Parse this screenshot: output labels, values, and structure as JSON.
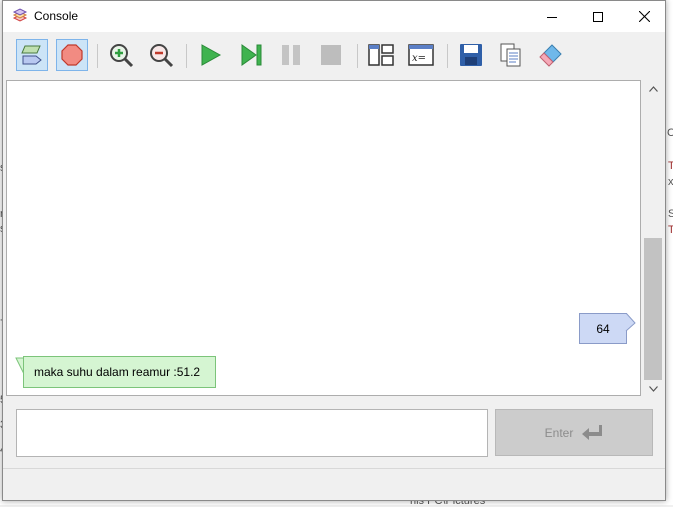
{
  "window": {
    "title": "Console"
  },
  "toolbar": {
    "buttons": [
      {
        "name": "input-mode-button",
        "icon": "parallelogram-icon"
      },
      {
        "name": "stop-sign-button",
        "icon": "octagon-icon"
      },
      {
        "name": "zoom-in-button",
        "icon": "zoom-in-icon"
      },
      {
        "name": "zoom-out-button",
        "icon": "zoom-out-icon"
      },
      {
        "name": "run-button",
        "icon": "play-icon"
      },
      {
        "name": "step-button",
        "icon": "step-icon"
      },
      {
        "name": "pause-button",
        "icon": "pause-icon"
      },
      {
        "name": "stop-button",
        "icon": "stop-icon"
      },
      {
        "name": "layout-button",
        "icon": "layout-icon"
      },
      {
        "name": "variables-button",
        "icon": "variables-icon"
      },
      {
        "name": "save-button",
        "icon": "save-icon"
      },
      {
        "name": "copy-button",
        "icon": "copy-icon"
      },
      {
        "name": "clear-button",
        "icon": "eraser-icon"
      }
    ]
  },
  "console": {
    "input_value": "64",
    "output_text": "maka suhu dalam reamur :51.2"
  },
  "input_bar": {
    "value": "",
    "enter_label": "Enter"
  },
  "background": {
    "fragments": [
      "s",
      "r",
      "s",
      "7",
      "5",
      "3",
      "4",
      "C",
      "T",
      "x",
      "S",
      "T",
      "his PC\\Pictures"
    ]
  }
}
